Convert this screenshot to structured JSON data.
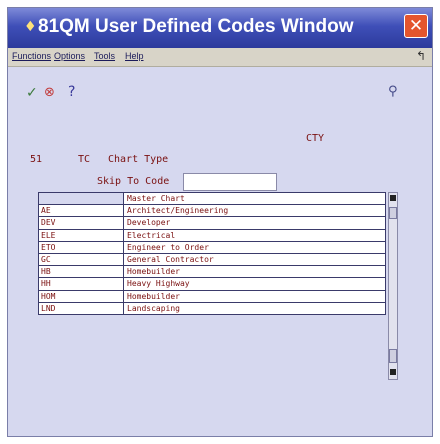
{
  "window": {
    "title": "81QM  User Defined Codes Window",
    "close_glyph": "✕"
  },
  "menubar": {
    "items": [
      "Functions",
      "Options",
      "Tools",
      "Help"
    ],
    "corner_icon": "exit-icon"
  },
  "toolbar": {
    "ok_icon": "checkmark-icon",
    "cancel_icon": "cancel-x-icon",
    "help_glyph": "?",
    "search_icon": "magnifier-icon"
  },
  "header": {
    "code_label": "CTY",
    "system_code": "51",
    "record_type": "TC",
    "description": "Chart Type",
    "skip_label": "Skip To Code",
    "skip_value": ""
  },
  "grid": {
    "rows": [
      {
        "code": "",
        "description": "Master Chart"
      },
      {
        "code": "AE",
        "description": "Architect/Engineering"
      },
      {
        "code": "DEV",
        "description": "Developer"
      },
      {
        "code": "ELE",
        "description": "Electrical"
      },
      {
        "code": "ETO",
        "description": "Engineer to Order"
      },
      {
        "code": "GC",
        "description": "General Contractor"
      },
      {
        "code": "HB",
        "description": "Homebuilder"
      },
      {
        "code": "HH",
        "description": "Heavy Highway"
      },
      {
        "code": "HOM",
        "description": "Homebuilder"
      },
      {
        "code": "LND",
        "description": "Landscaping"
      }
    ]
  }
}
